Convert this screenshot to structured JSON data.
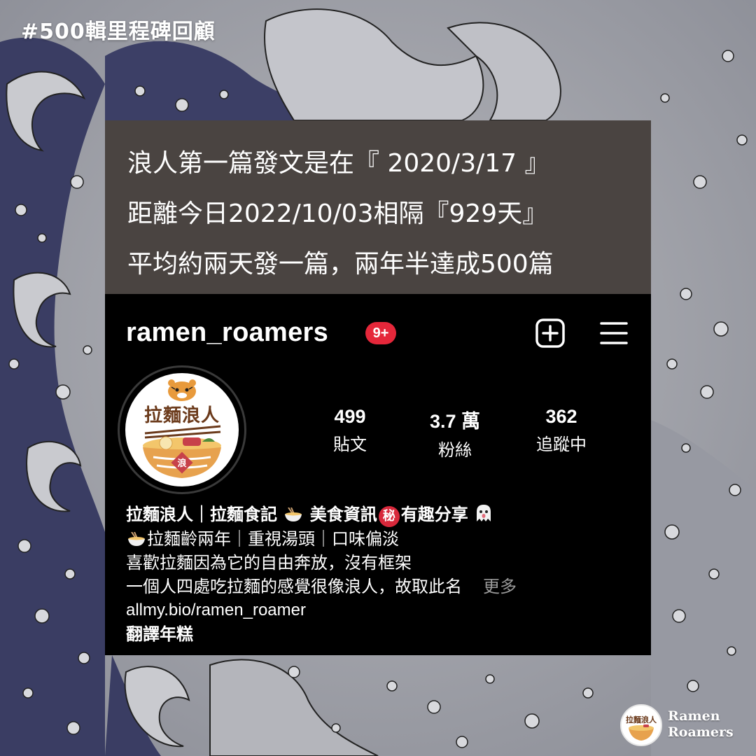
{
  "hashtag": "#500輯里程碑回顧",
  "caption": {
    "line1": "浪人第一篇發文是在『 2020/3/17 』",
    "line2": "距離今日2022/10/03相隔『929天』",
    "line3": "平均約兩天發一篇，兩年半達成500篇"
  },
  "profile": {
    "username": "ramen_roamers",
    "notification_badge": "9+",
    "add_icon": "plus-square-icon",
    "menu_icon": "hamburger-menu-icon",
    "avatar_text": "拉麵浪人",
    "avatar_seal": "浪",
    "stats": [
      {
        "value": "499",
        "label": "貼文"
      },
      {
        "value": "3.7 萬",
        "label": "粉絲"
      },
      {
        "value": "362",
        "label": "追蹤中"
      }
    ],
    "bio": {
      "line1_a": "拉麵浪人｜拉麵食記",
      "line1_b": " 美食資訊",
      "line1_secret": "秘",
      "line1_c": "有趣分享",
      "line2": "拉麵齡兩年｜重視湯頭｜口味偏淡",
      "line3": "喜歡拉麵因為它的自由奔放，沒有框架",
      "line4": "一個人四處吃拉麵的感覺很像浪人，故取此名",
      "more": "更多",
      "link": "allmy.bio/ramen_roamer",
      "translate": "翻譯年糕"
    }
  },
  "brand": {
    "logo_text": "拉麵浪人",
    "name_line1": "Ramen",
    "name_line2": "Roamers"
  },
  "colors": {
    "caption_bg": "#4a4441",
    "profile_bg": "#000000",
    "badge_red": "#e5273a",
    "wave_dark": "#3a3d63",
    "wave_light": "#c9cacf"
  }
}
